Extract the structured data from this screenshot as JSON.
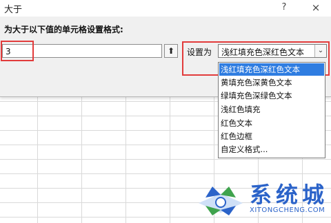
{
  "dialog": {
    "title": "大于",
    "help": "?",
    "close": "×",
    "prompt": "为大于以下值的单元格设置格式:",
    "value": "3",
    "ref_button_glyph": "⬆",
    "set_label": "设置为",
    "selected_format": "浅红填充色深红色文本",
    "dropdown_arrow": "⌄",
    "options": [
      "浅红填充色深红色文本",
      "黄填充色深黄色文本",
      "绿填充色深绿色文本",
      "浅红色填充",
      "红色文本",
      "红色边框",
      "自定义格式..."
    ],
    "highlight_color": "#2f7de1",
    "annotation_color": "#e23b3b"
  },
  "watermark": {
    "brand": "系统城",
    "url": "XITONGCHENG.COM"
  }
}
